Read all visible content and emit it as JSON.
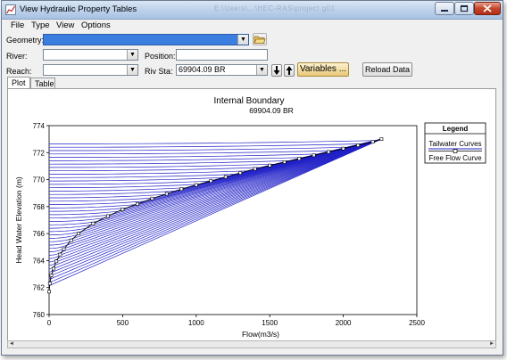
{
  "window": {
    "title": "View Hydraulic Property Tables",
    "title_path_blurred": "E:\\Users\\...\\HEC-RAS\\project.g01"
  },
  "menu": [
    "File",
    "Type",
    "View",
    "Options"
  ],
  "selectors": {
    "geometry_label": "Geometry:",
    "geometry_value": "",
    "river_label": "River:",
    "river_value": "",
    "position_label": "Position:",
    "position_value": "",
    "reach_label": "Reach:",
    "reach_value": "",
    "rivsta_label": "Riv Sta:",
    "rivsta_value": "69904.09 BR"
  },
  "buttons": {
    "variables": "Variables ...",
    "reload": "Reload Data"
  },
  "tabs": [
    "Plot",
    "Table"
  ],
  "chart_data": {
    "type": "line",
    "title": "Internal Boundary",
    "subtitle": "69904.09 BR",
    "xlabel": "Flow(m3/s)",
    "ylabel": "Head Water Elevation (m)",
    "xlim": [
      0,
      2500
    ],
    "ylim": [
      760,
      774
    ],
    "xticks": [
      "0",
      "500",
      "1000",
      "1500",
      "2000",
      "2500"
    ],
    "yticks": [
      "760",
      "762",
      "764",
      "766",
      "768",
      "770",
      "772",
      "774"
    ],
    "legend": {
      "title": "Legend",
      "placement": "right",
      "items": [
        "Tailwater Curves",
        "Free Flow Curve"
      ]
    },
    "colors": {
      "tailwater": "#2020c8",
      "freeflow": "#000000"
    },
    "free_flow_curve": {
      "x": [
        0,
        5,
        15,
        30,
        50,
        75,
        100,
        150,
        200,
        300,
        400,
        500,
        600,
        700,
        800,
        900,
        1000,
        1100,
        1200,
        1300,
        1400,
        1500,
        1600,
        1700,
        1800,
        1900,
        2000,
        2100,
        2200,
        2260
      ],
      "y": [
        761.7,
        762.3,
        762.9,
        763.4,
        763.95,
        764.45,
        764.85,
        765.5,
        766.0,
        766.75,
        767.3,
        767.8,
        768.2,
        768.6,
        768.95,
        769.3,
        769.6,
        769.9,
        770.2,
        770.5,
        770.8,
        771.05,
        771.3,
        771.55,
        771.8,
        772.05,
        772.3,
        772.55,
        772.8,
        773.0
      ]
    },
    "tailwater_curves": {
      "count": 44,
      "tailwater_elevations": [
        761.9,
        762.15,
        762.4,
        762.65,
        762.9,
        763.15,
        763.4,
        763.65,
        763.9,
        764.15,
        764.4,
        764.65,
        764.9,
        765.15,
        765.4,
        765.65,
        765.9,
        766.15,
        766.4,
        766.65,
        766.9,
        767.15,
        767.4,
        767.65,
        767.9,
        768.15,
        768.4,
        768.65,
        768.9,
        769.15,
        769.4,
        769.65,
        769.9,
        770.15,
        770.4,
        770.65,
        770.9,
        771.15,
        771.4,
        771.65,
        771.9,
        772.15,
        772.4,
        772.65
      ]
    }
  }
}
